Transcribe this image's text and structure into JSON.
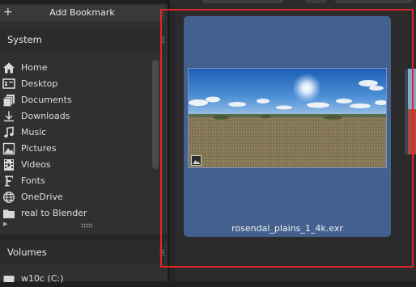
{
  "sidebar": {
    "add_bookmark_label": "Add Bookmark",
    "system_title": "System",
    "system_items": [
      {
        "label": "Home",
        "icon": "home-icon"
      },
      {
        "label": "Desktop",
        "icon": "desktop-icon"
      },
      {
        "label": "Documents",
        "icon": "documents-icon"
      },
      {
        "label": "Downloads",
        "icon": "downloads-icon"
      },
      {
        "label": "Music",
        "icon": "music-icon"
      },
      {
        "label": "Pictures",
        "icon": "pictures-icon"
      },
      {
        "label": "Videos",
        "icon": "videos-icon"
      },
      {
        "label": "Fonts",
        "icon": "fonts-icon"
      },
      {
        "label": "OneDrive",
        "icon": "onedrive-globe-icon"
      },
      {
        "label": "real to Blender",
        "icon": "folder-icon"
      }
    ],
    "volumes_title": "Volumes",
    "volumes_items": [
      {
        "label": "w10c (C:)",
        "icon": "drive-icon"
      }
    ]
  },
  "file_browser": {
    "thumbnail": {
      "filename": "rosendal_plains_1_4k.exr",
      "selected": true
    }
  },
  "colors": {
    "selection": "#43608f",
    "highlight_box": "#e0262b"
  }
}
